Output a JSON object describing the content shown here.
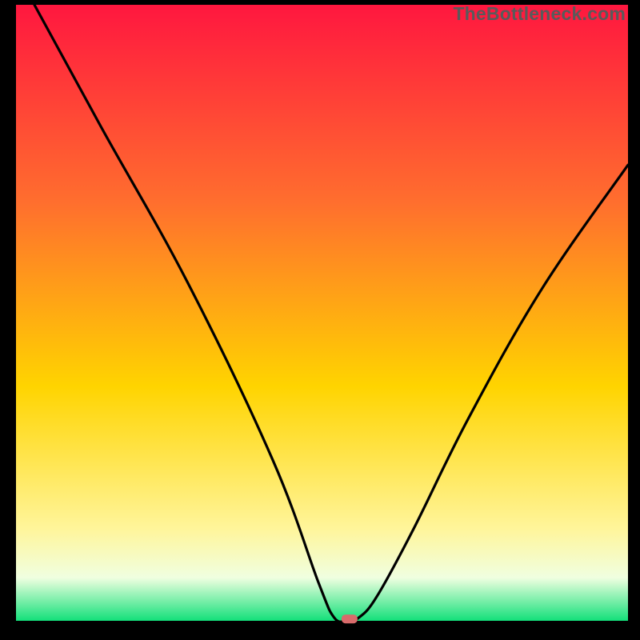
{
  "watermark": "TheBottleneck.com",
  "colors": {
    "top": "#ff173f",
    "mid_top": "#ff6e2e",
    "mid": "#ffd400",
    "low": "#fff59a",
    "pale": "#f0ffe0",
    "green": "#13e07a",
    "black": "#000000",
    "curve": "#000000",
    "marker": "#d86b6b"
  },
  "chart_data": {
    "type": "line",
    "title": "",
    "xlabel": "",
    "ylabel": "",
    "xlim": [
      0,
      100
    ],
    "ylim": [
      0,
      100
    ],
    "x": [
      3,
      14,
      28,
      42,
      49.5,
      52,
      54,
      56,
      59,
      65,
      74,
      86,
      100
    ],
    "y": [
      100,
      80,
      55,
      26,
      6,
      0.5,
      0,
      0.5,
      4,
      15,
      33,
      54,
      74
    ],
    "marker": {
      "x": 54.5,
      "y": 0.3
    },
    "annotations": []
  }
}
